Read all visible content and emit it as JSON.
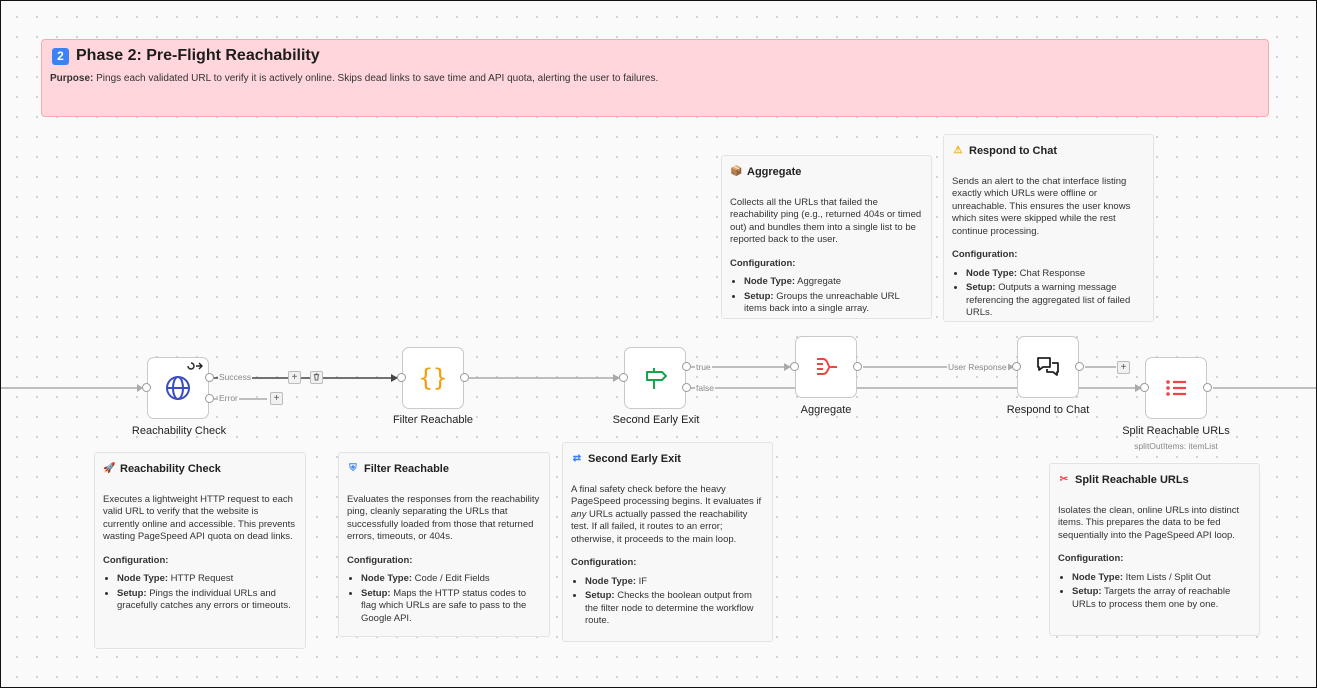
{
  "phase": {
    "number": "2",
    "title": "Phase 2: Pre-Flight Reachability",
    "purpose_label": "Purpose:",
    "purpose_text": " Pings each validated URL to verify it is actively online. Skips dead links to save time and API quota, alerting the user to failures."
  },
  "config_label": "Configuration:",
  "node_type_label": "Node Type:",
  "setup_label": "Setup:",
  "notes": {
    "reachability": {
      "icon": "rocket-icon",
      "title": "Reachability Check",
      "desc": "Executes a lightweight HTTP request to each valid URL to verify that the website is currently online and accessible. This prevents wasting PageSpeed API quota on dead links.",
      "node_type": " HTTP Request",
      "setup": " Pings the individual URLs and gracefully catches any errors or timeouts."
    },
    "filter": {
      "icon": "shield-icon",
      "title": "Filter Reachable",
      "desc": "Evaluates the responses from the reachability ping, cleanly separating the URLs that successfully loaded from those that returned errors, timeouts, or 404s.",
      "node_type": " Code / Edit Fields",
      "setup": " Maps the HTTP status codes to flag which URLs are safe to pass to the Google API."
    },
    "exit": {
      "icon": "split-icon",
      "title": "Second Early Exit",
      "desc_a": "A final safety check before the heavy PageSpeed processing begins. It evaluates if ",
      "desc_em": "any",
      "desc_b": " URLs actually passed the reachability test. If all failed, it routes to an error; otherwise, it proceeds to the main loop.",
      "node_type": " IF",
      "setup": " Checks the boolean output from the filter node to determine the workflow route."
    },
    "aggregate": {
      "icon": "box-icon",
      "title": "Aggregate",
      "desc": "Collects all the URLs that failed the reachability ping (e.g., returned 404s or timed out) and bundles them into a single list to be reported back to the user.",
      "node_type": " Aggregate",
      "setup": " Groups the unreachable URL items back into a single array."
    },
    "respond": {
      "icon": "warning-icon",
      "title": "Respond to Chat",
      "desc": "Sends an alert to the chat interface listing exactly which URLs were offline or unreachable. This ensures the user knows which sites were skipped while the rest continue processing.",
      "node_type": " Chat Response",
      "setup": " Outputs a warning message referencing the aggregated list of failed URLs."
    },
    "split": {
      "icon": "scissors-icon",
      "title": "Split Reachable URLs",
      "desc": "Isolates the clean, online URLs into distinct items. This prepares the data to be fed sequentially into the PageSpeed API loop.",
      "node_type": " Item Lists / Split Out",
      "setup": " Targets the array of reachable URLs to process them one by one."
    }
  },
  "nodes": {
    "reachability": {
      "label": "Reachability Check",
      "icon": "globe-icon"
    },
    "filter": {
      "label": "Filter Reachable",
      "icon": "braces-icon"
    },
    "exit": {
      "label": "Second Early Exit",
      "icon": "signpost-icon"
    },
    "aggregate": {
      "label": "Aggregate",
      "icon": "aggregate-icon"
    },
    "respond": {
      "label": "Respond to Chat",
      "icon": "chat-icon"
    },
    "split": {
      "label": "Split Reachable URLs",
      "sublabel": "splitOutItems: itemList",
      "icon": "list-icon"
    }
  },
  "edges": {
    "success": "Success",
    "error": "Error",
    "true": "true",
    "false": "false",
    "user_response": "User Response"
  },
  "colors": {
    "phase_bg": "#ffd6db",
    "globe": "#3b4cc0",
    "braces": "#f59e0b",
    "signpost": "#16a34a",
    "aggregate": "#ef4444",
    "list": "#ef4444"
  }
}
